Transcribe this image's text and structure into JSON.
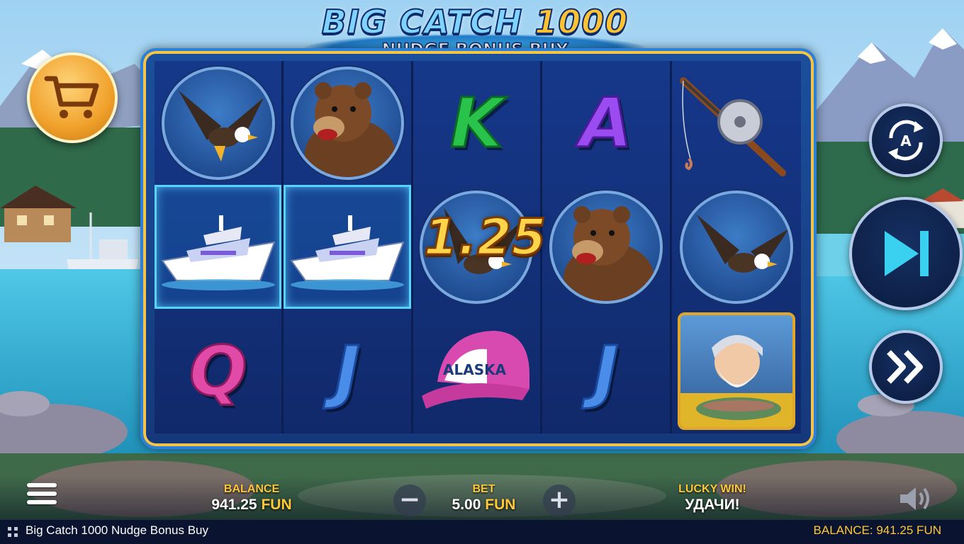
{
  "game": {
    "title_line1": "BIG CATCH",
    "title_number": "1000",
    "title_line2": "NUDGE BONUS BUY"
  },
  "reels": [
    [
      "eagle",
      "boat",
      "Q"
    ],
    [
      "bear",
      "boat",
      "J"
    ],
    [
      "K",
      "eagle",
      "cap"
    ],
    [
      "A",
      "bear",
      "J"
    ],
    [
      "fishing-rod",
      "eagle",
      "fisherman"
    ]
  ],
  "symbols": {
    "K": "K",
    "A": "A",
    "Q": "Q",
    "J": "J",
    "cap_text": "ALASKA"
  },
  "win": {
    "amount": "1.25"
  },
  "hud": {
    "balance_label": "BALANCE",
    "balance_value": "941.25",
    "balance_currency": "FUN",
    "bet_label": "BET",
    "bet_value": "5.00",
    "bet_currency": "FUN",
    "lucky_label": "LUCKY WIN!",
    "lucky_message": "УДАЧИ!",
    "minus": "−",
    "plus": "+"
  },
  "status_bar": {
    "game_name": "Big Catch 1000 Nudge Bonus Buy",
    "balance_text": "BALANCE: 941.25 FUN"
  },
  "icons": {
    "buy": "cart-icon",
    "autoplay": "autoplay-icon",
    "spin": "skip-icon",
    "turbo": "fast-forward-icon",
    "menu": "hamburger-icon",
    "sound": "speaker-icon"
  },
  "colors": {
    "accent_gold": "#ffc83a",
    "reel_bg": "#143478",
    "frame_border": "#f4c548"
  }
}
